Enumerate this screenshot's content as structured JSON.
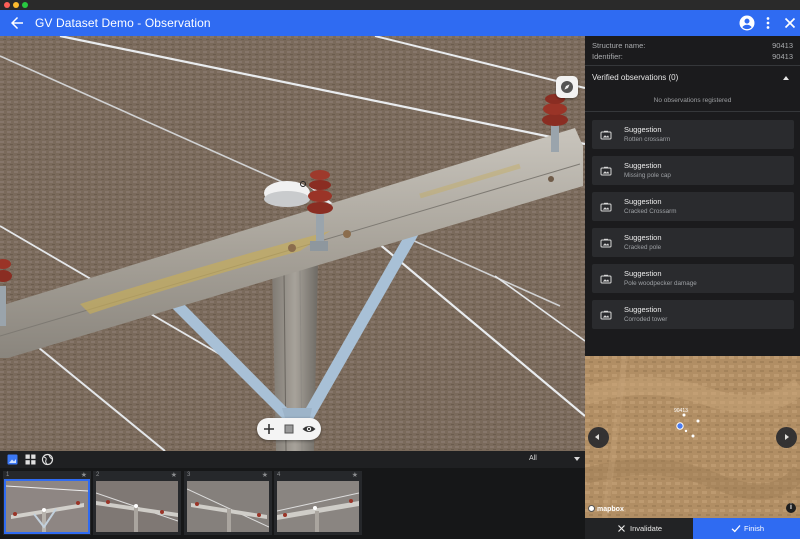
{
  "app": {
    "title": "GV Dataset Demo - Observation"
  },
  "structure": {
    "name_label": "Structure name:",
    "name_value": "90413",
    "id_label": "Identifier:",
    "id_value": "90413"
  },
  "observations": {
    "header": "Verified observations (0)",
    "empty_message": "No observations registered"
  },
  "suggestions": [
    {
      "title": "Suggestion",
      "subtitle": "Rotten crossarm"
    },
    {
      "title": "Suggestion",
      "subtitle": "Missing pole cap"
    },
    {
      "title": "Suggestion",
      "subtitle": "Cracked Crossarm"
    },
    {
      "title": "Suggestion",
      "subtitle": "Cracked pole"
    },
    {
      "title": "Suggestion",
      "subtitle": "Pole woodpecker damage"
    },
    {
      "title": "Suggestion",
      "subtitle": "Corroded tower"
    }
  ],
  "filter": {
    "selected": "All"
  },
  "thumbnails": [
    {
      "number": "1",
      "star": "★",
      "selected": true
    },
    {
      "number": "2",
      "star": "★",
      "selected": false
    },
    {
      "number": "3",
      "star": "★",
      "selected": false
    },
    {
      "number": "4",
      "star": "★",
      "selected": false
    }
  ],
  "map": {
    "marker_label": "90413",
    "attribution": "mapbox",
    "info": "i"
  },
  "actions": {
    "invalidate": "Invalidate",
    "finish": "Finish"
  },
  "colors": {
    "accent": "#2f6bf2",
    "panel_bg": "#1b1b1d",
    "card_bg": "#2a2b2e"
  },
  "icons": {
    "back": "arrow-left-icon",
    "account": "account-icon",
    "more": "more-vertical-icon",
    "close": "close-icon",
    "compass": "compass-icon",
    "add": "plus-icon",
    "square": "square-icon",
    "eye": "eye-icon",
    "camera": "camera-icon"
  }
}
